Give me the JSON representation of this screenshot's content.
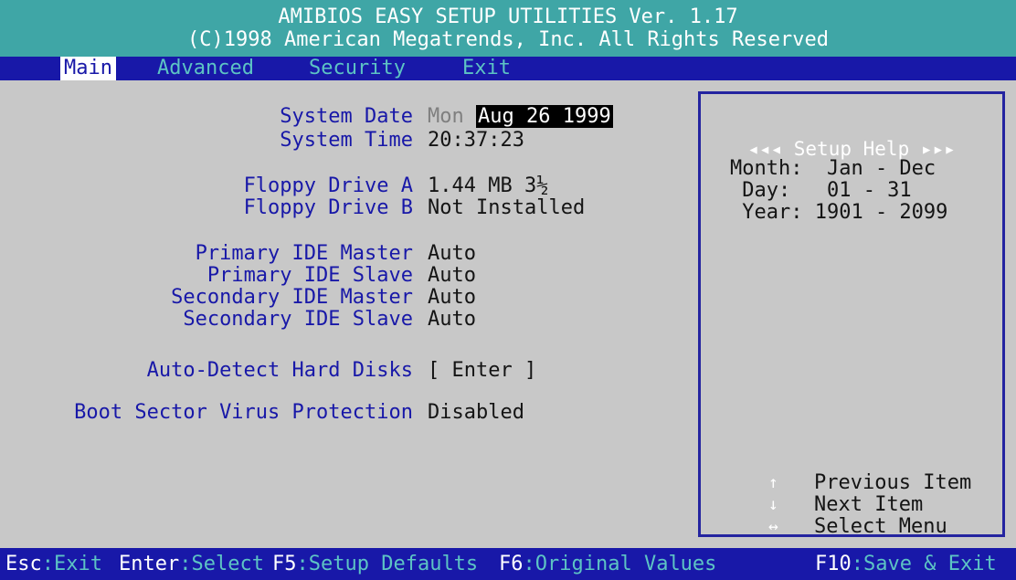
{
  "header": {
    "title": "AMIBIOS EASY SETUP UTILITIES Ver. 1.17",
    "copyright": "(C)1998 American Megatrends, Inc. All Rights Reserved"
  },
  "menu": [
    {
      "label": "Main",
      "active": true
    },
    {
      "label": "Advanced",
      "active": false
    },
    {
      "label": "Security",
      "active": false
    },
    {
      "label": "Exit",
      "active": false
    }
  ],
  "settings": {
    "system_date": {
      "label": "System Date",
      "day": "Mon",
      "value": "Aug 26 1999"
    },
    "system_time": {
      "label": "System Time",
      "value": "20:37:23"
    },
    "floppy_a": {
      "label": "Floppy Drive A",
      "value": "1.44 MB 3½"
    },
    "floppy_b": {
      "label": "Floppy Drive B",
      "value": "Not Installed"
    },
    "primary_master": {
      "label": "Primary IDE Master",
      "value": "Auto"
    },
    "primary_slave": {
      "label": "Primary IDE Slave",
      "value": "Auto"
    },
    "secondary_master": {
      "label": "Secondary IDE Master",
      "value": "Auto"
    },
    "secondary_slave": {
      "label": "Secondary IDE Slave",
      "value": "Auto"
    },
    "auto_detect": {
      "label": "Auto-Detect Hard Disks",
      "value": "[ Enter ]"
    },
    "boot_virus": {
      "label": "Boot Sector Virus Protection",
      "value": "Disabled"
    }
  },
  "help": {
    "title": "◂◂◂ Setup Help ▸▸▸",
    "lines": [
      "Month:  Jan - Dec",
      " Day:   01 - 31",
      " Year: 1901 - 2099"
    ],
    "keys": [
      {
        "icon": "↑",
        "label": "Previous Item"
      },
      {
        "icon": "↓",
        "label": "Next Item"
      },
      {
        "icon": "↔",
        "label": "Select Menu"
      }
    ]
  },
  "footer": [
    {
      "key": "Esc",
      "desc": ":Exit"
    },
    {
      "key": "Enter",
      "desc": ":Select"
    },
    {
      "key": "F5",
      "desc": ":Setup Defaults"
    },
    {
      "key": "F6",
      "desc": ":Original Values"
    },
    {
      "key": "F10",
      "desc": ":Save & Exit"
    }
  ],
  "colors": {
    "header_bg": "#3fa6a6",
    "menubar_bg": "#1818a8",
    "panel_bg": "#c8c8c8",
    "label_color": "#1818a8",
    "menu_text": "#5dc4c4"
  }
}
